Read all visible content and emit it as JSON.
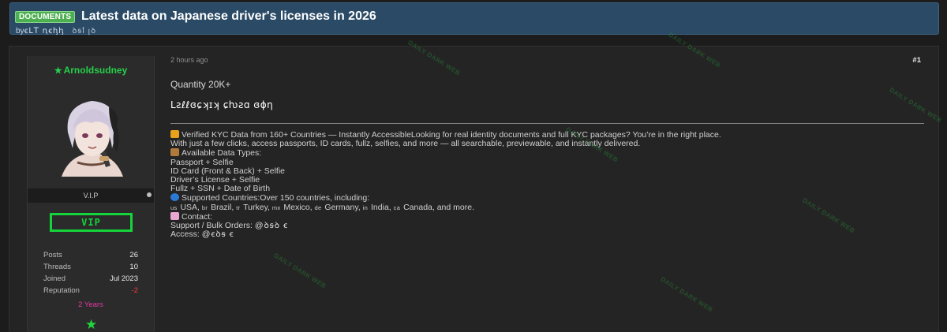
{
  "thread": {
    "tag": "DOCUMENTS",
    "title": "Latest data on Japanese driver's licenses in 2026",
    "byline_prefix": "by",
    "author_obscured": "ꞓԼꓔ ꞑꞓꞕꞕ",
    "date_obscured": "ꝺꞩꝉ ꞁꝺ"
  },
  "post": {
    "time": "2 hours ago",
    "number": "#1",
    "quantity": "Quantity 20K+",
    "obscured_line": "Lƨℓℓɞɕʞɪʞ ɕƕƨɑ ɞɸƞ",
    "lines": [
      {
        "icon": "lock-icon",
        "text": "Verified KYC Data from 160+ Countries — Instantly AccessibleLooking for real identity documents and full KYC packages? You’re in the right place."
      },
      {
        "icon": "",
        "text": "With just a few clicks, access passports, ID cards, fullz, selfies, and more — all searchable, previewable, and instantly delivered."
      },
      {
        "icon": "package-icon",
        "text": "Available Data Types:"
      },
      {
        "icon": "",
        "text": "Passport + Selfie"
      },
      {
        "icon": "",
        "text": "ID Card (Front & Back) + Selfie"
      },
      {
        "icon": "",
        "text": "Driver’s License + Selfie"
      },
      {
        "icon": "",
        "text": "Fullz + SSN + Date of Birth"
      },
      {
        "icon": "globe-icon",
        "text": "Supported Countries:Over 150 countries, including:"
      }
    ],
    "countries": [
      {
        "code": "us",
        "name": "USA"
      },
      {
        "code": "br",
        "name": "Brazil"
      },
      {
        "code": "tr",
        "name": "Turkey"
      },
      {
        "code": "mx",
        "name": "Mexico"
      },
      {
        "code": "de",
        "name": "Germany"
      },
      {
        "code": "in",
        "name": "India"
      },
      {
        "code": "ca",
        "name": "Canada"
      }
    ],
    "countries_suffix": ", and more.",
    "contact_label": "Contact:",
    "support_label": "Support / Bulk Orders:",
    "support_value": "@ꝺꞩꝺ ꞓ",
    "access_label": "Access:",
    "access_value": "@ꞓꝺꞩ ꞓ"
  },
  "user": {
    "name": "Arnoldsudney",
    "rank": "V.I.P",
    "badge": "VIP",
    "stats": [
      {
        "label": "Posts",
        "value": "26"
      },
      {
        "label": "Threads",
        "value": "10"
      },
      {
        "label": "Joined",
        "value": "Jul 2023"
      },
      {
        "label": "Reputation",
        "value": "-2"
      }
    ],
    "tenure": "2 Years"
  },
  "watermark_text": "DAILY DARK WEB",
  "colors": {
    "header_bg": "#2a4a66",
    "tag_bg": "#4caf50",
    "username": "#25d04a",
    "vip_badge": "#15d43a",
    "reputation_negative": "#ff3a3a",
    "tenure": "#e03aa0"
  }
}
